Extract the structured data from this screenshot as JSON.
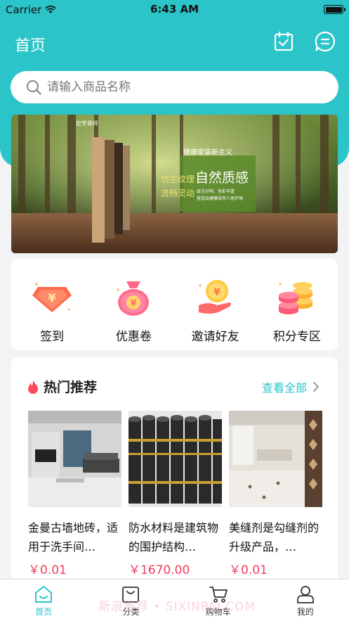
{
  "status_bar": {
    "carrier": "Carrier",
    "time": "6:43 AM"
  },
  "header": {
    "title": "首页",
    "icons": [
      "calendar-check-icon",
      "message-icon"
    ],
    "accent": "#2bc4c9"
  },
  "search": {
    "placeholder": "请输入商品名称"
  },
  "banner": {
    "brand": "宏宇瓷砖",
    "tagline_top": "健康家装新主义",
    "slogan_left_1": "仿生纹理",
    "slogan_left_2": "流畅灵动",
    "headline": "自然质感",
    "sub_1": "层次分明，色彩丰富",
    "sub_2": "营造出健康自然人居环境"
  },
  "quick_menu": [
    {
      "label": "签到",
      "icon": "diamond-coin-icon"
    },
    {
      "label": "优惠卷",
      "icon": "money-bag-icon"
    },
    {
      "label": "邀请好友",
      "icon": "coin-hand-icon"
    },
    {
      "label": "积分专区",
      "icon": "coin-stack-icon"
    }
  ],
  "hot": {
    "title": "热门推荐",
    "view_all": "查看全部",
    "products": [
      {
        "name": "金曼古墙地砖，适用于洗手间…",
        "price": "￥0.01"
      },
      {
        "name": "防水材料是建筑物的围护结构…",
        "price": "￥1670.00"
      },
      {
        "name": "美缝剂是勾缝剂的升级产品，…",
        "price": "￥0.01"
      }
    ]
  },
  "watermark": "新浪推荐 • SIXINPAI.COM",
  "tabbar": [
    {
      "label": "首页",
      "icon": "home-icon",
      "active": true
    },
    {
      "label": "分类",
      "icon": "shopping-bag-icon",
      "active": false
    },
    {
      "label": "购物车",
      "icon": "cart-icon",
      "active": false
    },
    {
      "label": "我的",
      "icon": "user-icon",
      "active": false
    }
  ]
}
